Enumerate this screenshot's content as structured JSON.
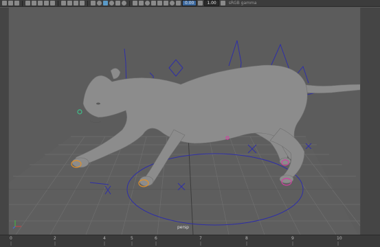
{
  "toolbar": {
    "field_a": "0.00",
    "field_b": "1.00",
    "color_space": "sRGB gamma"
  },
  "viewport": {
    "camera_label": "persp"
  },
  "timeline": {
    "frames": [
      "0",
      "2",
      "4",
      "5",
      "6",
      "7",
      "8",
      "9",
      "10"
    ]
  },
  "colors": {
    "viewport_bg": "#5c5c5c",
    "grid": "#6e6e6e",
    "rig_curves": "#2a2a9a",
    "model": "#8c8c8c",
    "accent": "#3d6aa0"
  }
}
